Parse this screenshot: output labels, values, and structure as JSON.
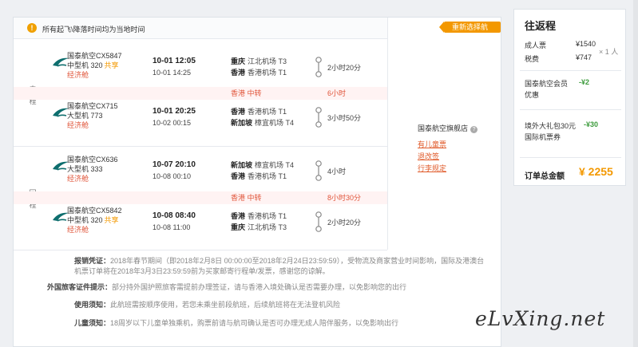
{
  "notice": "所有起飞\\降落时间均为当地时间",
  "reselect": "重新选择航班",
  "outbound_label": "去程",
  "return_label": "回程",
  "flights": [
    {
      "airline": "国泰航空CX5847",
      "aircraft": "中型机 320",
      "share": "共享",
      "cabin": "经济舱",
      "dep_time": "10-01 12:05",
      "arr_time": "10-01 14:25",
      "dep_city": "重庆",
      "dep_airport": "江北机场 T3",
      "arr_city": "香港",
      "arr_airport": "香港机场 T1",
      "duration": "2小时20分"
    },
    {
      "airline": "国泰航空CX715",
      "aircraft": "大型机 773",
      "share": "",
      "cabin": "经济舱",
      "dep_time": "10-01 20:25",
      "arr_time": "10-02 00:15",
      "dep_city": "香港",
      "dep_airport": "香港机场 T1",
      "arr_city": "新加坡",
      "arr_airport": "樟宜机场 T4",
      "duration": "3小时50分"
    },
    {
      "airline": "国泰航空CX636",
      "aircraft": "大型机 333",
      "share": "",
      "cabin": "经济舱",
      "dep_time": "10-07 20:10",
      "arr_time": "10-08 00:10",
      "dep_city": "新加坡",
      "dep_airport": "樟宜机场 T4",
      "arr_city": "香港",
      "arr_airport": "香港机场 T1",
      "duration": "4小时"
    },
    {
      "airline": "国泰航空CX5842",
      "aircraft": "中型机 320",
      "share": "共享",
      "cabin": "经济舱",
      "dep_time": "10-08 08:40",
      "arr_time": "10-08 11:00",
      "dep_city": "香港",
      "dep_airport": "香港机场 T1",
      "arr_city": "重庆",
      "arr_airport": "江北机场 T3",
      "duration": "2小时20分"
    }
  ],
  "transfers": [
    {
      "city": "香港 中转",
      "duration": "6小时"
    },
    {
      "city": "香港 中转",
      "duration": "8小时30分"
    }
  ],
  "side": {
    "store": "国泰航空旗舰店",
    "links": [
      "有儿童票",
      "退改签",
      "行李规定"
    ]
  },
  "policies": [
    {
      "title": "报销凭证：",
      "text": "2018年春节期间（即2018年2月8日 00:00:00至2018年2月24日23:59:59），受物流及商家营业时间影响，国际及港澳台机票订单将在2018年3月3日23:59:59前为买家邮寄行程单/发票，感谢您的谅解。"
    },
    {
      "title": "外国旅客证件提示：",
      "text": "部分持外国护照旅客需提前办理签证，请与香港入境处确认是否需要办理，以免影响您的出行"
    },
    {
      "title": "使用须知：",
      "text": "此航班需按顺序使用，若您未乘坐前段航班，后续航班将在无法登机风险"
    },
    {
      "title": "儿童须知：",
      "text": "18周岁以下儿童单独乘机，购票前请与航司确认是否可办理无成人陪伴服务，以免影响出行"
    }
  ],
  "panel": {
    "title": "往返程",
    "adult_label": "成人票",
    "adult_price": "¥1540",
    "qty": "× 1 人",
    "tax_label": "税费",
    "tax_price": "¥747",
    "member_label": "国泰航空会员优惠",
    "member_val": "-¥2",
    "gift_label": "境外大礼包30元国际机票券",
    "gift_val": "-¥30",
    "total_label": "订单总金额",
    "total_val": "¥ 2255"
  },
  "watermark": "eLvXing.net",
  "colors": {
    "accent": "#f39800",
    "cabin": "#e0553a",
    "green": "#3c9b3c",
    "airline": "#0e6e6e"
  }
}
